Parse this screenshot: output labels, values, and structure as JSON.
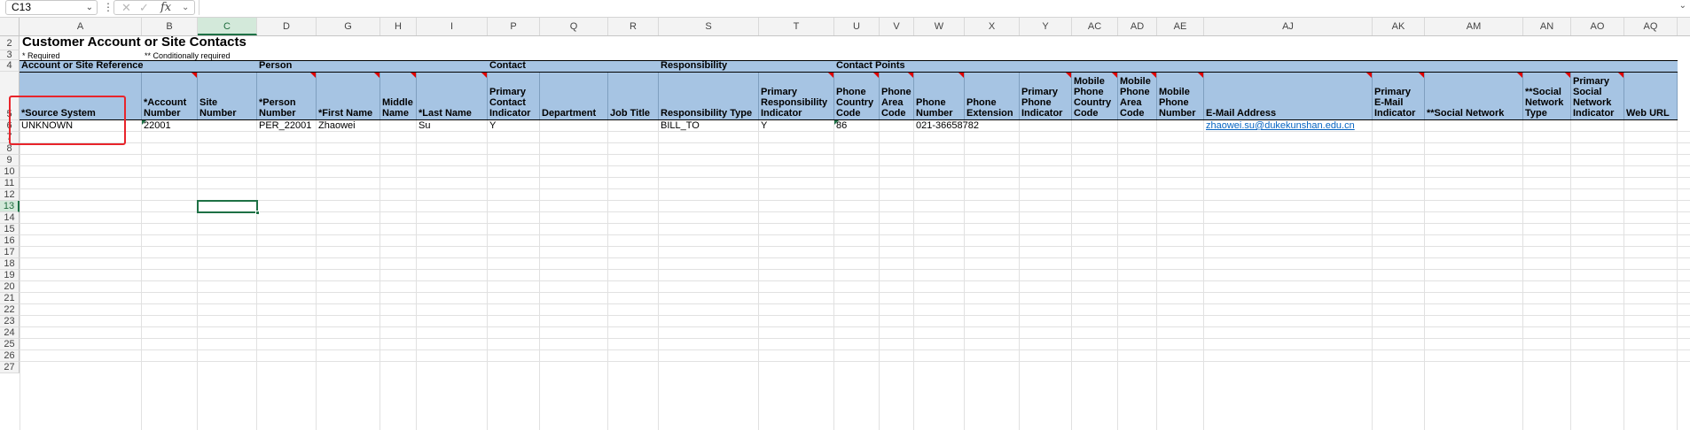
{
  "formula_bar": {
    "name_box": "C13",
    "fx_label": "fx",
    "formula": ""
  },
  "columns": [
    "A",
    "B",
    "C",
    "D",
    "G",
    "H",
    "I",
    "P",
    "Q",
    "R",
    "S",
    "T",
    "U",
    "V",
    "W",
    "X",
    "Y",
    "AC",
    "AD",
    "AE",
    "AJ",
    "AK",
    "AM",
    "AN",
    "AO",
    "AQ"
  ],
  "rows": [
    "2",
    "3",
    "4",
    "5",
    "6",
    "7",
    "8",
    "9",
    "10",
    "11",
    "12",
    "13",
    "14",
    "15",
    "16",
    "17",
    "18",
    "19",
    "20",
    "21",
    "22",
    "23",
    "24",
    "25",
    "26",
    "27"
  ],
  "sheet": {
    "title": "Customer Account or Site Contacts",
    "note_required": "* Required",
    "note_conditional": "** Conditionally required",
    "groups": [
      "Account or Site Reference",
      "Person",
      "Contact",
      "Responsibility",
      "Contact Points"
    ],
    "headers": [
      "*Source System",
      "*Account Number",
      "Site Number",
      "*Person Number",
      "*First Name",
      "Middle Name",
      "*Last Name",
      "Primary Contact Indicator",
      "Department",
      "Job Title",
      "Responsibility Type",
      "Primary Responsibility Indicator",
      "Phone Country Code",
      "Phone Area Code",
      "Phone Number",
      "Phone Extension",
      "Primary Phone Indicator",
      "Mobile Phone Country Code",
      "Mobile Phone Area Code",
      "Mobile Phone Number",
      "E-Mail Address",
      "Primary E-Mail Indicator",
      "**Social Network",
      "**Social Network Type",
      "Primary Social Network Indicator",
      "Web URL"
    ],
    "row6": [
      "UNKNOWN",
      "22001",
      "",
      "PER_22001",
      "Zhaowei",
      "",
      "Su",
      "Y",
      "",
      "",
      "BILL_TO",
      "Y",
      "86",
      "",
      "021-36658782",
      "",
      "",
      "",
      "",
      "",
      "zhaowei.su@dukekunshan.edu.cn",
      "",
      "",
      "",
      "",
      ""
    ]
  },
  "colors": {
    "header_blue": "#a6c4e3",
    "selection_green": "#1e7145",
    "highlight_red": "#e8242b",
    "link_blue": "#0563c1"
  }
}
